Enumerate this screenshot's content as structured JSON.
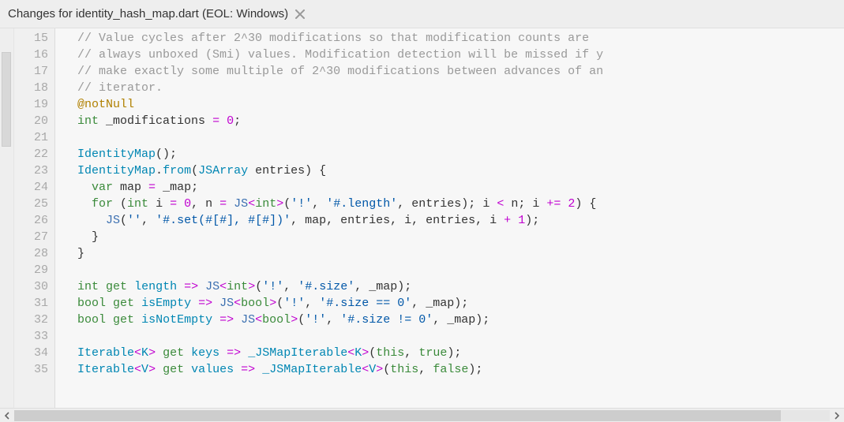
{
  "tab": {
    "title": "Changes for identity_hash_map.dart (EOL: Windows)"
  },
  "gutter": {
    "start": 15,
    "end": 35
  },
  "code": {
    "lines": [
      [
        {
          "t": "indent",
          "v": "  "
        },
        {
          "t": "cmt",
          "v": "// Value cycles after 2^30 modifications so that modification counts are"
        }
      ],
      [
        {
          "t": "indent",
          "v": "  "
        },
        {
          "t": "cmt",
          "v": "// always unboxed (Smi) values. Modification detection will be missed if y"
        }
      ],
      [
        {
          "t": "indent",
          "v": "  "
        },
        {
          "t": "cmt",
          "v": "// make exactly some multiple of 2^30 modifications between advances of an"
        }
      ],
      [
        {
          "t": "indent",
          "v": "  "
        },
        {
          "t": "cmt",
          "v": "// iterator."
        }
      ],
      [
        {
          "t": "indent",
          "v": "  "
        },
        {
          "t": "ann",
          "v": "@notNull"
        }
      ],
      [
        {
          "t": "indent",
          "v": "  "
        },
        {
          "t": "kw",
          "v": "int"
        },
        {
          "t": "id",
          "v": " _modifications "
        },
        {
          "t": "op",
          "v": "="
        },
        {
          "t": "id",
          "v": " "
        },
        {
          "t": "num",
          "v": "0"
        },
        {
          "t": "id",
          "v": ";"
        }
      ],
      [],
      [
        {
          "t": "indent",
          "v": "  "
        },
        {
          "t": "cls",
          "v": "IdentityMap"
        },
        {
          "t": "id",
          "v": "();"
        }
      ],
      [
        {
          "t": "indent",
          "v": "  "
        },
        {
          "t": "cls",
          "v": "IdentityMap"
        },
        {
          "t": "id",
          "v": "."
        },
        {
          "t": "mth",
          "v": "from"
        },
        {
          "t": "id",
          "v": "("
        },
        {
          "t": "typ",
          "v": "JSArray"
        },
        {
          "t": "id",
          "v": " entries) {"
        }
      ],
      [
        {
          "t": "indent",
          "v": "    "
        },
        {
          "t": "kw",
          "v": "var"
        },
        {
          "t": "id",
          "v": " map "
        },
        {
          "t": "op",
          "v": "="
        },
        {
          "t": "id",
          "v": " _map;"
        }
      ],
      [
        {
          "t": "indent",
          "v": "    "
        },
        {
          "t": "kw",
          "v": "for"
        },
        {
          "t": "id",
          "v": " ("
        },
        {
          "t": "kw",
          "v": "int"
        },
        {
          "t": "id",
          "v": " i "
        },
        {
          "t": "op",
          "v": "="
        },
        {
          "t": "id",
          "v": " "
        },
        {
          "t": "num",
          "v": "0"
        },
        {
          "t": "id",
          "v": ", n "
        },
        {
          "t": "op",
          "v": "="
        },
        {
          "t": "id",
          "v": " "
        },
        {
          "t": "fn",
          "v": "JS"
        },
        {
          "t": "ang",
          "v": "<"
        },
        {
          "t": "kw",
          "v": "int"
        },
        {
          "t": "ang",
          "v": ">"
        },
        {
          "t": "id",
          "v": "("
        },
        {
          "t": "str",
          "v": "'!'"
        },
        {
          "t": "id",
          "v": ", "
        },
        {
          "t": "str",
          "v": "'#.length'"
        },
        {
          "t": "id",
          "v": ", entries); i "
        },
        {
          "t": "op",
          "v": "<"
        },
        {
          "t": "id",
          "v": " n; i "
        },
        {
          "t": "op",
          "v": "+="
        },
        {
          "t": "id",
          "v": " "
        },
        {
          "t": "num",
          "v": "2"
        },
        {
          "t": "id",
          "v": ") {"
        }
      ],
      [
        {
          "t": "indent",
          "v": "      "
        },
        {
          "t": "fn",
          "v": "JS"
        },
        {
          "t": "id",
          "v": "("
        },
        {
          "t": "str",
          "v": "''"
        },
        {
          "t": "id",
          "v": ", "
        },
        {
          "t": "str",
          "v": "'#.set(#[#], #[#])'"
        },
        {
          "t": "id",
          "v": ", map, entries, i, entries, i "
        },
        {
          "t": "op",
          "v": "+"
        },
        {
          "t": "id",
          "v": " "
        },
        {
          "t": "num",
          "v": "1"
        },
        {
          "t": "id",
          "v": ");"
        }
      ],
      [
        {
          "t": "indent",
          "v": "    "
        },
        {
          "t": "id",
          "v": "}"
        }
      ],
      [
        {
          "t": "indent",
          "v": "  "
        },
        {
          "t": "id",
          "v": "}"
        }
      ],
      [],
      [
        {
          "t": "indent",
          "v": "  "
        },
        {
          "t": "kw",
          "v": "int"
        },
        {
          "t": "id",
          "v": " "
        },
        {
          "t": "kw",
          "v": "get"
        },
        {
          "t": "id",
          "v": " "
        },
        {
          "t": "prop",
          "v": "length"
        },
        {
          "t": "id",
          "v": " "
        },
        {
          "t": "op",
          "v": "=>"
        },
        {
          "t": "id",
          "v": " "
        },
        {
          "t": "fn",
          "v": "JS"
        },
        {
          "t": "ang",
          "v": "<"
        },
        {
          "t": "kw",
          "v": "int"
        },
        {
          "t": "ang",
          "v": ">"
        },
        {
          "t": "id",
          "v": "("
        },
        {
          "t": "str",
          "v": "'!'"
        },
        {
          "t": "id",
          "v": ", "
        },
        {
          "t": "str",
          "v": "'#.size'"
        },
        {
          "t": "id",
          "v": ", _map);"
        }
      ],
      [
        {
          "t": "indent",
          "v": "  "
        },
        {
          "t": "kw",
          "v": "bool"
        },
        {
          "t": "id",
          "v": " "
        },
        {
          "t": "kw",
          "v": "get"
        },
        {
          "t": "id",
          "v": " "
        },
        {
          "t": "prop",
          "v": "isEmpty"
        },
        {
          "t": "id",
          "v": " "
        },
        {
          "t": "op",
          "v": "=>"
        },
        {
          "t": "id",
          "v": " "
        },
        {
          "t": "fn",
          "v": "JS"
        },
        {
          "t": "ang",
          "v": "<"
        },
        {
          "t": "kw",
          "v": "bool"
        },
        {
          "t": "ang",
          "v": ">"
        },
        {
          "t": "id",
          "v": "("
        },
        {
          "t": "str",
          "v": "'!'"
        },
        {
          "t": "id",
          "v": ", "
        },
        {
          "t": "str",
          "v": "'#.size == 0'"
        },
        {
          "t": "id",
          "v": ", _map);"
        }
      ],
      [
        {
          "t": "indent",
          "v": "  "
        },
        {
          "t": "kw",
          "v": "bool"
        },
        {
          "t": "id",
          "v": " "
        },
        {
          "t": "kw",
          "v": "get"
        },
        {
          "t": "id",
          "v": " "
        },
        {
          "t": "prop",
          "v": "isNotEmpty"
        },
        {
          "t": "id",
          "v": " "
        },
        {
          "t": "op",
          "v": "=>"
        },
        {
          "t": "id",
          "v": " "
        },
        {
          "t": "fn",
          "v": "JS"
        },
        {
          "t": "ang",
          "v": "<"
        },
        {
          "t": "kw",
          "v": "bool"
        },
        {
          "t": "ang",
          "v": ">"
        },
        {
          "t": "id",
          "v": "("
        },
        {
          "t": "str",
          "v": "'!'"
        },
        {
          "t": "id",
          "v": ", "
        },
        {
          "t": "str",
          "v": "'#.size != 0'"
        },
        {
          "t": "id",
          "v": ", _map);"
        }
      ],
      [],
      [
        {
          "t": "indent",
          "v": "  "
        },
        {
          "t": "typ",
          "v": "Iterable"
        },
        {
          "t": "ang",
          "v": "<"
        },
        {
          "t": "typ",
          "v": "K"
        },
        {
          "t": "ang",
          "v": ">"
        },
        {
          "t": "id",
          "v": " "
        },
        {
          "t": "kw",
          "v": "get"
        },
        {
          "t": "id",
          "v": " "
        },
        {
          "t": "prop",
          "v": "keys"
        },
        {
          "t": "id",
          "v": " "
        },
        {
          "t": "op",
          "v": "=>"
        },
        {
          "t": "id",
          "v": " "
        },
        {
          "t": "typ",
          "v": "_JSMapIterable"
        },
        {
          "t": "ang",
          "v": "<"
        },
        {
          "t": "typ",
          "v": "K"
        },
        {
          "t": "ang",
          "v": ">"
        },
        {
          "t": "id",
          "v": "("
        },
        {
          "t": "kw",
          "v": "this"
        },
        {
          "t": "id",
          "v": ", "
        },
        {
          "t": "kw",
          "v": "true"
        },
        {
          "t": "id",
          "v": ");"
        }
      ],
      [
        {
          "t": "indent",
          "v": "  "
        },
        {
          "t": "typ",
          "v": "Iterable"
        },
        {
          "t": "ang",
          "v": "<"
        },
        {
          "t": "typ",
          "v": "V"
        },
        {
          "t": "ang",
          "v": ">"
        },
        {
          "t": "id",
          "v": " "
        },
        {
          "t": "kw",
          "v": "get"
        },
        {
          "t": "id",
          "v": " "
        },
        {
          "t": "prop",
          "v": "values"
        },
        {
          "t": "id",
          "v": " "
        },
        {
          "t": "op",
          "v": "=>"
        },
        {
          "t": "id",
          "v": " "
        },
        {
          "t": "typ",
          "v": "_JSMapIterable"
        },
        {
          "t": "ang",
          "v": "<"
        },
        {
          "t": "typ",
          "v": "V"
        },
        {
          "t": "ang",
          "v": ">"
        },
        {
          "t": "id",
          "v": "("
        },
        {
          "t": "kw",
          "v": "this"
        },
        {
          "t": "id",
          "v": ", "
        },
        {
          "t": "kw",
          "v": "false"
        },
        {
          "t": "id",
          "v": ");"
        }
      ]
    ]
  }
}
